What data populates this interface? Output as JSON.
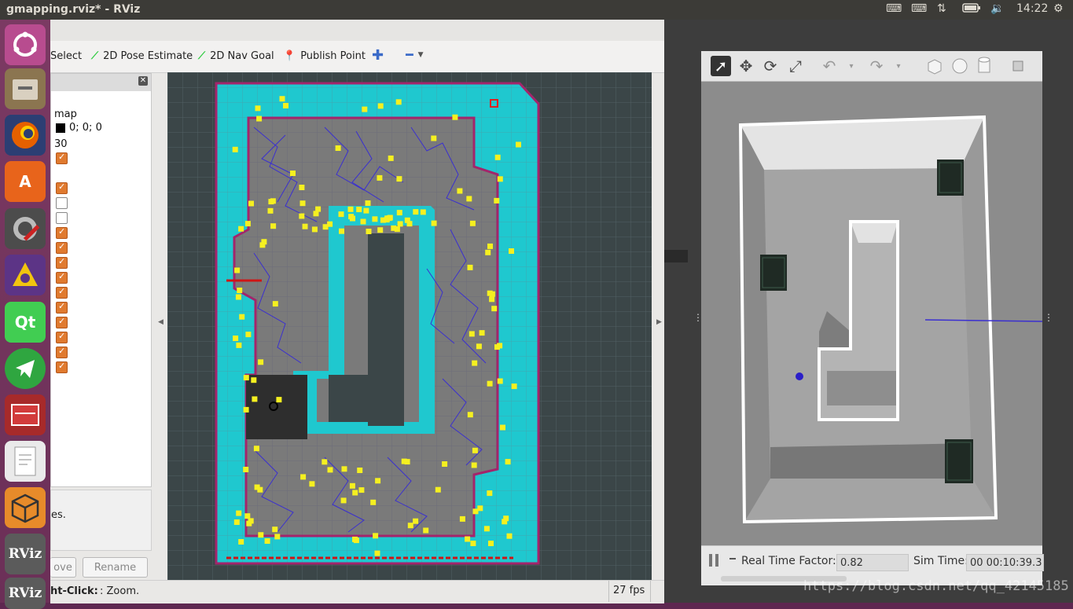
{
  "topbar": {
    "window_title": "gmapping.rviz* - RViz",
    "time": "14:22",
    "indicators": [
      "keyboard-icon",
      "keyboard-icon",
      "network-updown-icon",
      "battery-icon",
      "volume-icon"
    ]
  },
  "launcher": {
    "items": [
      {
        "name": "ubuntu-dash-icon",
        "label": "",
        "color": "#7a3b6a"
      },
      {
        "name": "files-icon",
        "label": "",
        "color": "#8a6a3a"
      },
      {
        "name": "firefox-icon",
        "label": "",
        "color": "#e66000"
      },
      {
        "name": "software-center-icon",
        "label": "A",
        "color": "#e8641b"
      },
      {
        "name": "settings-icon",
        "label": "",
        "color": "#606060"
      },
      {
        "name": "network-app-icon",
        "label": "",
        "color": "#6a3d8a"
      },
      {
        "name": "qt-creator-icon",
        "label": "Qt",
        "color": "#41cd52"
      },
      {
        "name": "telegram-icon",
        "label": "",
        "color": "#2fa640"
      },
      {
        "name": "terminal-app-icon",
        "label": "",
        "color": "#b02a2a"
      },
      {
        "name": "text-editor-icon",
        "label": "",
        "color": "#ddd"
      },
      {
        "name": "rviz-box-icon",
        "label": "",
        "color": "#e78b2a"
      },
      {
        "name": "rviz-app-icon",
        "label": "RViz",
        "color": "#666"
      },
      {
        "name": "rviz-app-icon-2",
        "label": "RViz",
        "color": "#666"
      }
    ]
  },
  "rviz": {
    "toolbar": {
      "select": "Select",
      "pose_estimate": "2D Pose Estimate",
      "nav_goal": "2D Nav Goal",
      "publish_point": "Publish Point"
    },
    "displays": {
      "fixed_frame_value": "map",
      "background_value": "0; 0; 0",
      "frame_rate_value": "30",
      "checkboxes": [
        true,
        true,
        false,
        false,
        true,
        true,
        true,
        true,
        true,
        true,
        true,
        true,
        true,
        true
      ]
    },
    "description_text": "es.",
    "buttons": {
      "remove": "ove",
      "rename": "Rename"
    },
    "status": {
      "hint": "ht-Click:",
      "hint_rest": ": Zoom.",
      "fps": "27 fps"
    }
  },
  "gazebo": {
    "real_time_factor_label": "Real Time Factor:",
    "real_time_factor_value": "0.82",
    "sim_time_label": "Sim Time:",
    "sim_time_value": "00 00:10:39.3"
  },
  "watermark": "https://blog.csdn.net/qq_42145185"
}
